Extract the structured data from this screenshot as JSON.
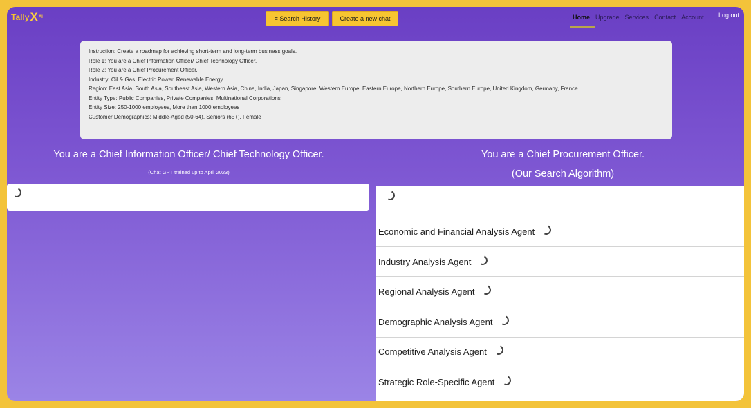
{
  "nav": {
    "logo_text": "Tally",
    "logo_x": "X",
    "logo_ai": "AI",
    "search_history": "≡ Search History",
    "new_chat": "Create a new chat",
    "links": [
      "Home",
      "Upgrade",
      "Services",
      "Contact",
      "Account"
    ],
    "logout": "Log out"
  },
  "instruction": {
    "lines": [
      "Instruction: Create a roadmap for achieving short-term and long-term business goals.",
      "Role 1: You are a Chief Information Officer/ Chief Technology Officer.",
      "Role 2: You are a Chief Procurement Officer.",
      "Industry: Oil & Gas, Electric Power, Renewable Energy",
      "Region: East Asia, South Asia, Southeast Asia, Western Asia, China, India, Japan, Singapore, Western Europe, Eastern Europe, Northern Europe, Southern Europe, United Kingdom, Germany, France",
      "Entity Type: Public Companies, Private Companies, Multinational Corporations",
      "Entity Size: 250-1000 employees, More than 1000 employees",
      "Customer Demographics: Middle-Aged (50-64), Seniors (65+), Female"
    ]
  },
  "left": {
    "title": "You are a Chief Information Officer/ Chief Technology Officer.",
    "subtitle": "(Chat GPT trained up to April 2023)"
  },
  "right": {
    "title": "You are a Chief Procurement Officer.",
    "subtitle": "(Our Search Algorithm)",
    "agents": [
      "Economic and Financial Analysis Agent",
      "Industry Analysis Agent",
      "Regional Analysis Agent",
      "Demographic Analysis Agent",
      "Competitive Analysis Agent",
      "Strategic Role-Specific Agent"
    ]
  },
  "colors": {
    "accent": "#f7c531",
    "background_top": "#6a3fc4",
    "background_bottom": "#9b84e6",
    "border": "#f3c33a"
  }
}
